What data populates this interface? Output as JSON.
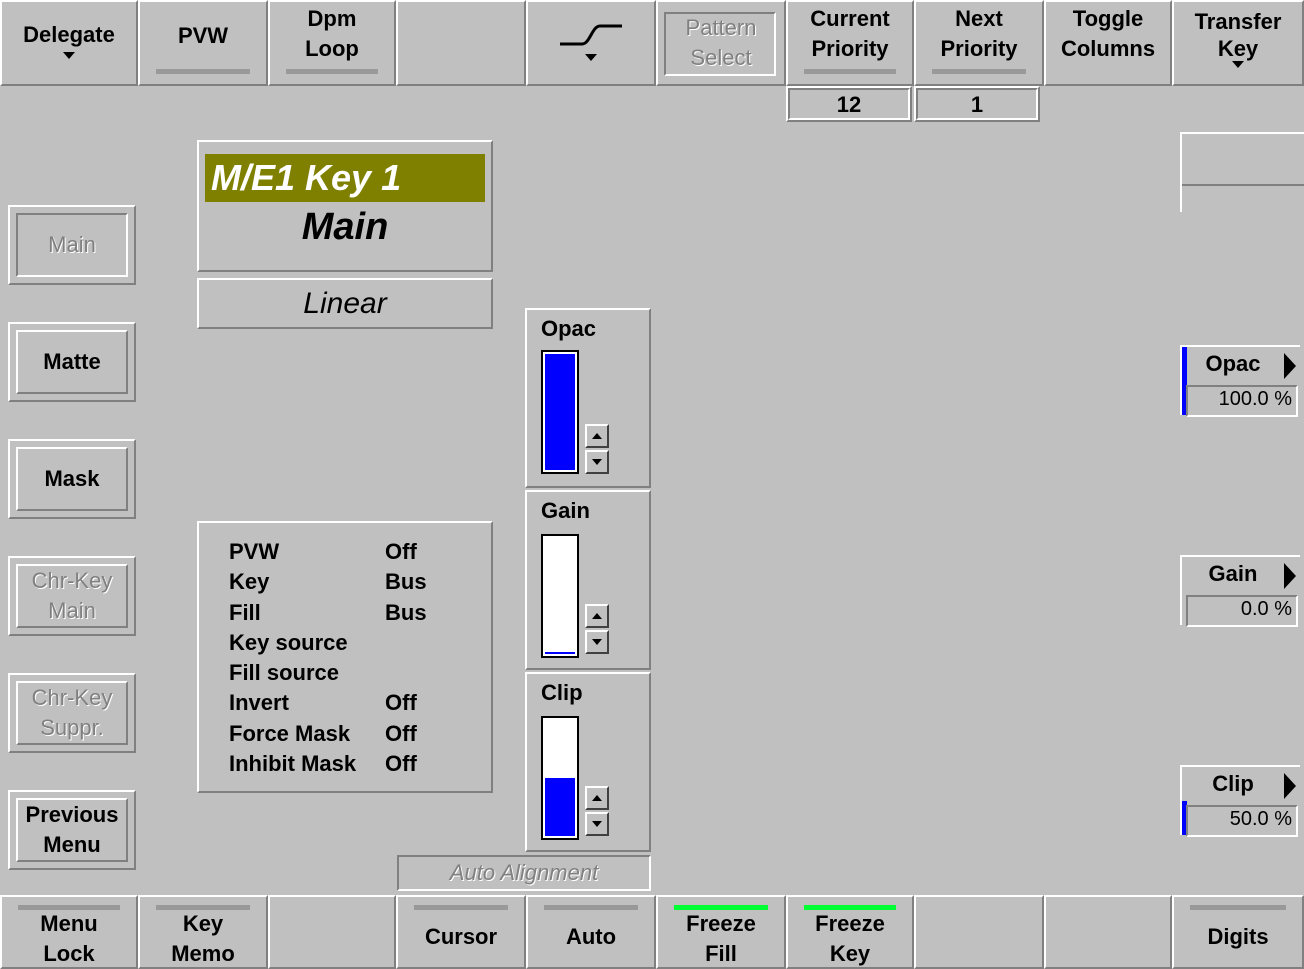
{
  "toolbar": {
    "delegate": "Delegate",
    "pvw": "PVW",
    "dpm_line1": "Dpm",
    "dpm_line2": "Loop",
    "pattern_line1": "Pattern",
    "pattern_line2": "Select",
    "current_line1": "Current",
    "current_line2": "Priority",
    "next_line1": "Next",
    "next_line2": "Priority",
    "toggle_line1": "Toggle",
    "toggle_line2": "Columns",
    "transfer_line1": "Transfer",
    "transfer_line2": "Key"
  },
  "priority": {
    "current": "12",
    "next": "1"
  },
  "key_title": {
    "name": "M/E1 Key 1",
    "mode": "Main",
    "type": "Linear"
  },
  "side_menu": {
    "main": "Main",
    "matte": "Matte",
    "mask": "Mask",
    "chr_main_1": "Chr-Key",
    "chr_main_2": "Main",
    "chr_suppr_1": "Chr-Key",
    "chr_suppr_2": "Suppr.",
    "prev_1": "Previous",
    "prev_2": "Menu"
  },
  "status": [
    {
      "key": "PVW",
      "value": "Off"
    },
    {
      "key": "Key",
      "value": "Bus"
    },
    {
      "key": "Fill",
      "value": "Bus"
    },
    {
      "key": "Key source",
      "value": ""
    },
    {
      "key": "Fill source",
      "value": ""
    },
    {
      "key": "Invert",
      "value": "Off"
    },
    {
      "key": "Force Mask",
      "value": "Off"
    },
    {
      "key": "Inhibit Mask",
      "value": "Off"
    }
  ],
  "sliders": {
    "opac": {
      "label": "Opac",
      "level": 1.0
    },
    "gain": {
      "label": "Gain",
      "level": 0.0
    },
    "clip": {
      "label": "Clip",
      "level": 0.5
    }
  },
  "params": {
    "opac": {
      "label": "Opac",
      "value": "100.0 %",
      "level": 1.0
    },
    "gain": {
      "label": "Gain",
      "value": "0.0 %",
      "level": 0.0
    },
    "clip": {
      "label": "Clip",
      "value": "50.0 %",
      "level": 0.5
    }
  },
  "auto_alignment": "Auto Alignment",
  "bottom": {
    "menu_lock_1": "Menu",
    "menu_lock_2": "Lock",
    "key_memo_1": "Key",
    "key_memo_2": "Memo",
    "cursor": "Cursor",
    "auto": "Auto",
    "freeze_fill_1": "Freeze",
    "freeze_fill_2": "Fill",
    "freeze_key_1": "Freeze",
    "freeze_key_2": "Key",
    "digits": "Digits"
  },
  "colors": {
    "background": "#c0c0c0",
    "title_bar": "#808000",
    "indicator_blue": "#0000ff",
    "active_green": "#00ff33"
  }
}
